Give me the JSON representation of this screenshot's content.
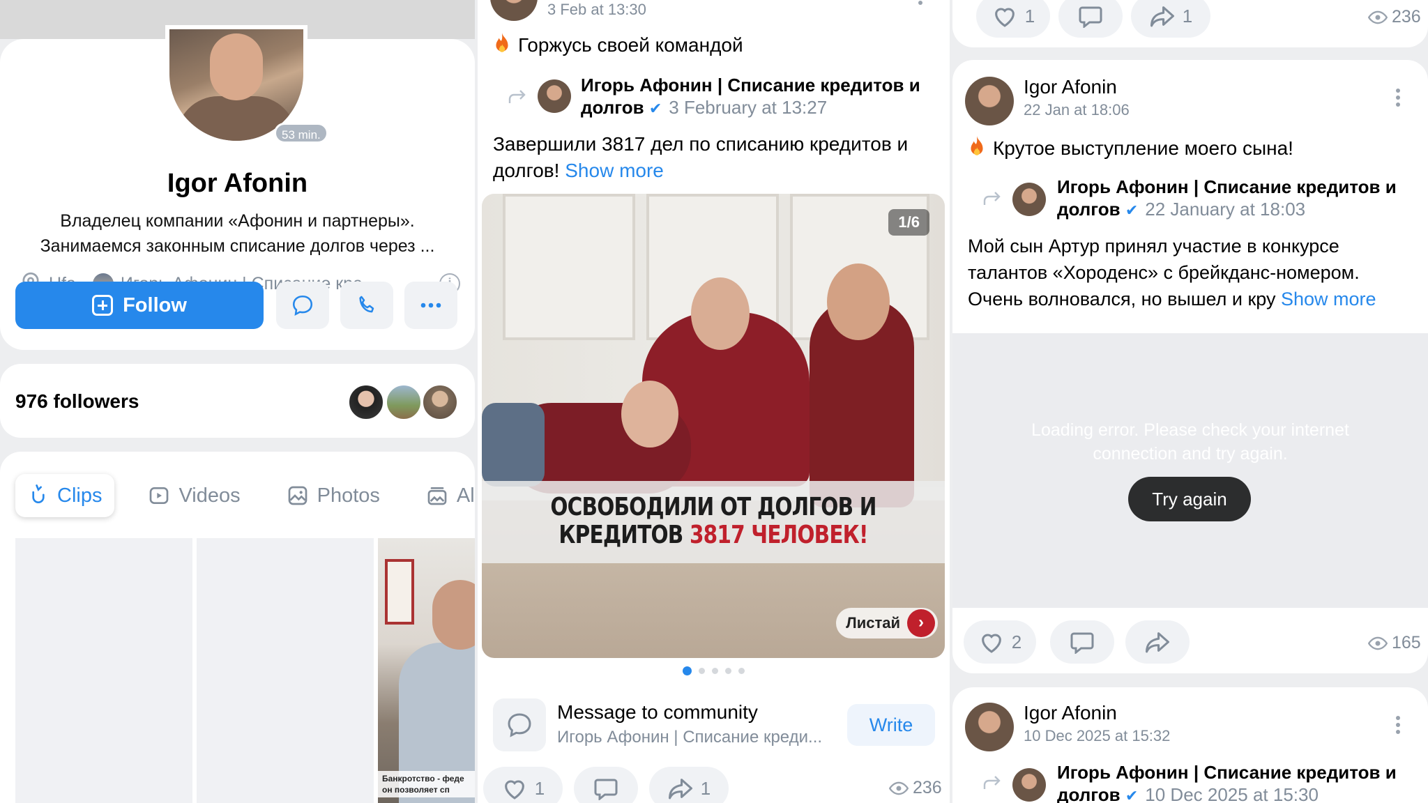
{
  "profile": {
    "name": "Igor Afonin",
    "online": "53 min.",
    "bio_line1": "Владелец компании «Афонин и партнеры».",
    "bio_line2": "Занимаемся законным списание долгов через ...",
    "city": "Ufa",
    "community": "Игорь Афонин | Списание кре...",
    "follow_label": "Follow",
    "followers": "976 followers"
  },
  "tabs": [
    {
      "label": "Clips",
      "icon": "clips-icon"
    },
    {
      "label": "Videos",
      "icon": "video-icon"
    },
    {
      "label": "Photos",
      "icon": "photo-icon"
    },
    {
      "label": "Albu",
      "icon": "album-icon"
    }
  ],
  "clip_caption": {
    "line1": "Банкротство - феде",
    "line2": "он позволяет сп"
  },
  "post1": {
    "date": "3 Feb at 13:30",
    "text": "Горжусь своей командой",
    "repost_name_line1": "Игорь Афонин | Списание кредитов и",
    "repost_name_line2": "долгов",
    "repost_date": "3 February at 13:27",
    "body_line1": "Завершили 3817 дел по списанию кредитов и",
    "body_line2": "долгов!",
    "show_more": "Show more",
    "image_counter": "1/6",
    "banner_line1": "ОСВОБОДИЛИ ОТ ДОЛГОВ И",
    "banner_line2a": "КРЕДИТОВ",
    "banner_line2b": "3817 ЧЕЛОВЕК!",
    "swipe_label": "Листай",
    "message_title": "Message to community",
    "message_sub": "Игорь Афонин | Списание креди...",
    "write_label": "Write",
    "likes": "1",
    "shares": "1",
    "views": "236"
  },
  "col3": {
    "top_likes": "1",
    "top_shares": "1",
    "top_views": "236",
    "post2": {
      "author": "Igor Afonin",
      "date": "22 Jan at 18:06",
      "text": "Крутое выступление моего сына!",
      "repost_name_line1": "Игорь Афонин | Списание кредитов и",
      "repost_name_line2": "долгов",
      "repost_date": "22 January at 18:03",
      "body_line1": "Мой сын Артур принял участие в конкурсе",
      "body_line2": "талантов «Хороденс» с брейкданс-номером.",
      "body_line3": "Очень волновался, но вышел и кру",
      "show_more": "Show more",
      "error_line1": "Loading error. Please check your internet",
      "error_line2": "connection and try again.",
      "retry_label": "Try again",
      "likes": "2",
      "views": "165"
    },
    "post3": {
      "author": "Igor Afonin",
      "date": "10 Dec 2025 at 15:32",
      "repost_name_line1": "Игорь Афонин | Списание кредитов и",
      "repost_name_line2": "долгов",
      "repost_date": "10 Dec 2025 at 15:30"
    }
  },
  "colors": {
    "accent": "#2688eb",
    "muted": "#818c99",
    "bg": "#edeef0",
    "banner_red": "#c0202c"
  }
}
